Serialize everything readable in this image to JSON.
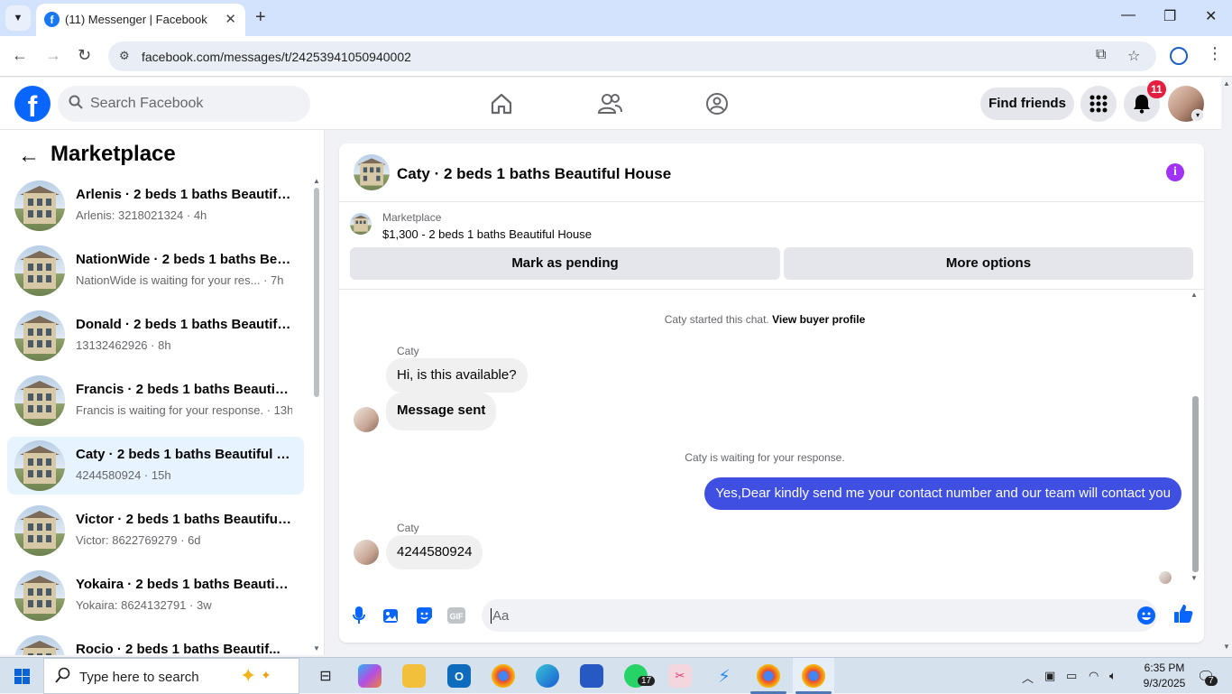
{
  "browser": {
    "tab_title": "(11) Messenger | Facebook",
    "url": "facebook.com/messages/t/24253941050940002"
  },
  "header": {
    "search_placeholder": "Search Facebook",
    "find_friends_label": "Find friends",
    "notification_count": "11"
  },
  "sidebar": {
    "title": "Marketplace",
    "conversations": [
      {
        "name": "Arlenis · 2 beds 1 baths Beautiful...",
        "subtitle": "Arlenis: 3218021324 · 4h",
        "active": false
      },
      {
        "name": "NationWide · 2 beds 1 baths Bea...",
        "subtitle": "NationWide is waiting for your res... · 7h",
        "active": false
      },
      {
        "name": "Donald · 2 beds 1 baths Beautifu...",
        "subtitle": "13132462926 · 8h",
        "active": false
      },
      {
        "name": "Francis · 2 beds 1 baths Beautiful...",
        "subtitle": "Francis is waiting for your response. · 13h",
        "active": false
      },
      {
        "name": "Caty · 2 beds 1 baths Beautiful H...",
        "subtitle": "4244580924 · 15h",
        "active": true
      },
      {
        "name": "Victor · 2 beds 1 baths Beautiful ...",
        "subtitle": "Victor: 8622769279 · 6d",
        "active": false
      },
      {
        "name": "Yokaira · 2 beds 1 baths Beautiful...",
        "subtitle": "Yokaira: 8624132791 · 3w",
        "active": false
      },
      {
        "name": "Rocio · 2 beds 1 baths Beautif...",
        "subtitle": "",
        "active": false
      }
    ]
  },
  "chat": {
    "title": "Caty · 2 beds 1 baths Beautiful House",
    "marketplace_label": "Marketplace",
    "listing": "$1,300 - 2 beds 1 baths Beautiful House",
    "mark_pending_label": "Mark as pending",
    "more_options_label": "More options",
    "started_text": "Caty started this chat.",
    "view_profile_label": "View buyer profile",
    "sender_name": "Caty",
    "msg_1": "Hi, is this available?",
    "msg_2": "Message sent",
    "waiting_text": "Caty is waiting for your response.",
    "outgoing_msg": "Yes,Dear kindly send me your contact number and our team will contact you",
    "sender_name_2": "Caty",
    "msg_3": "4244580924",
    "composer_placeholder": "Aa"
  },
  "taskbar": {
    "search_placeholder": "Type here to search",
    "time": "6:35 PM",
    "date": "9/3/2025",
    "whatsapp_badge": "17",
    "chat_badge": "7"
  },
  "colors": {
    "fb_blue": "#0866ff",
    "outgoing_bubble": "#3e4fe2",
    "notification_red": "#e41e3f",
    "info_purple": "#a033f5"
  }
}
